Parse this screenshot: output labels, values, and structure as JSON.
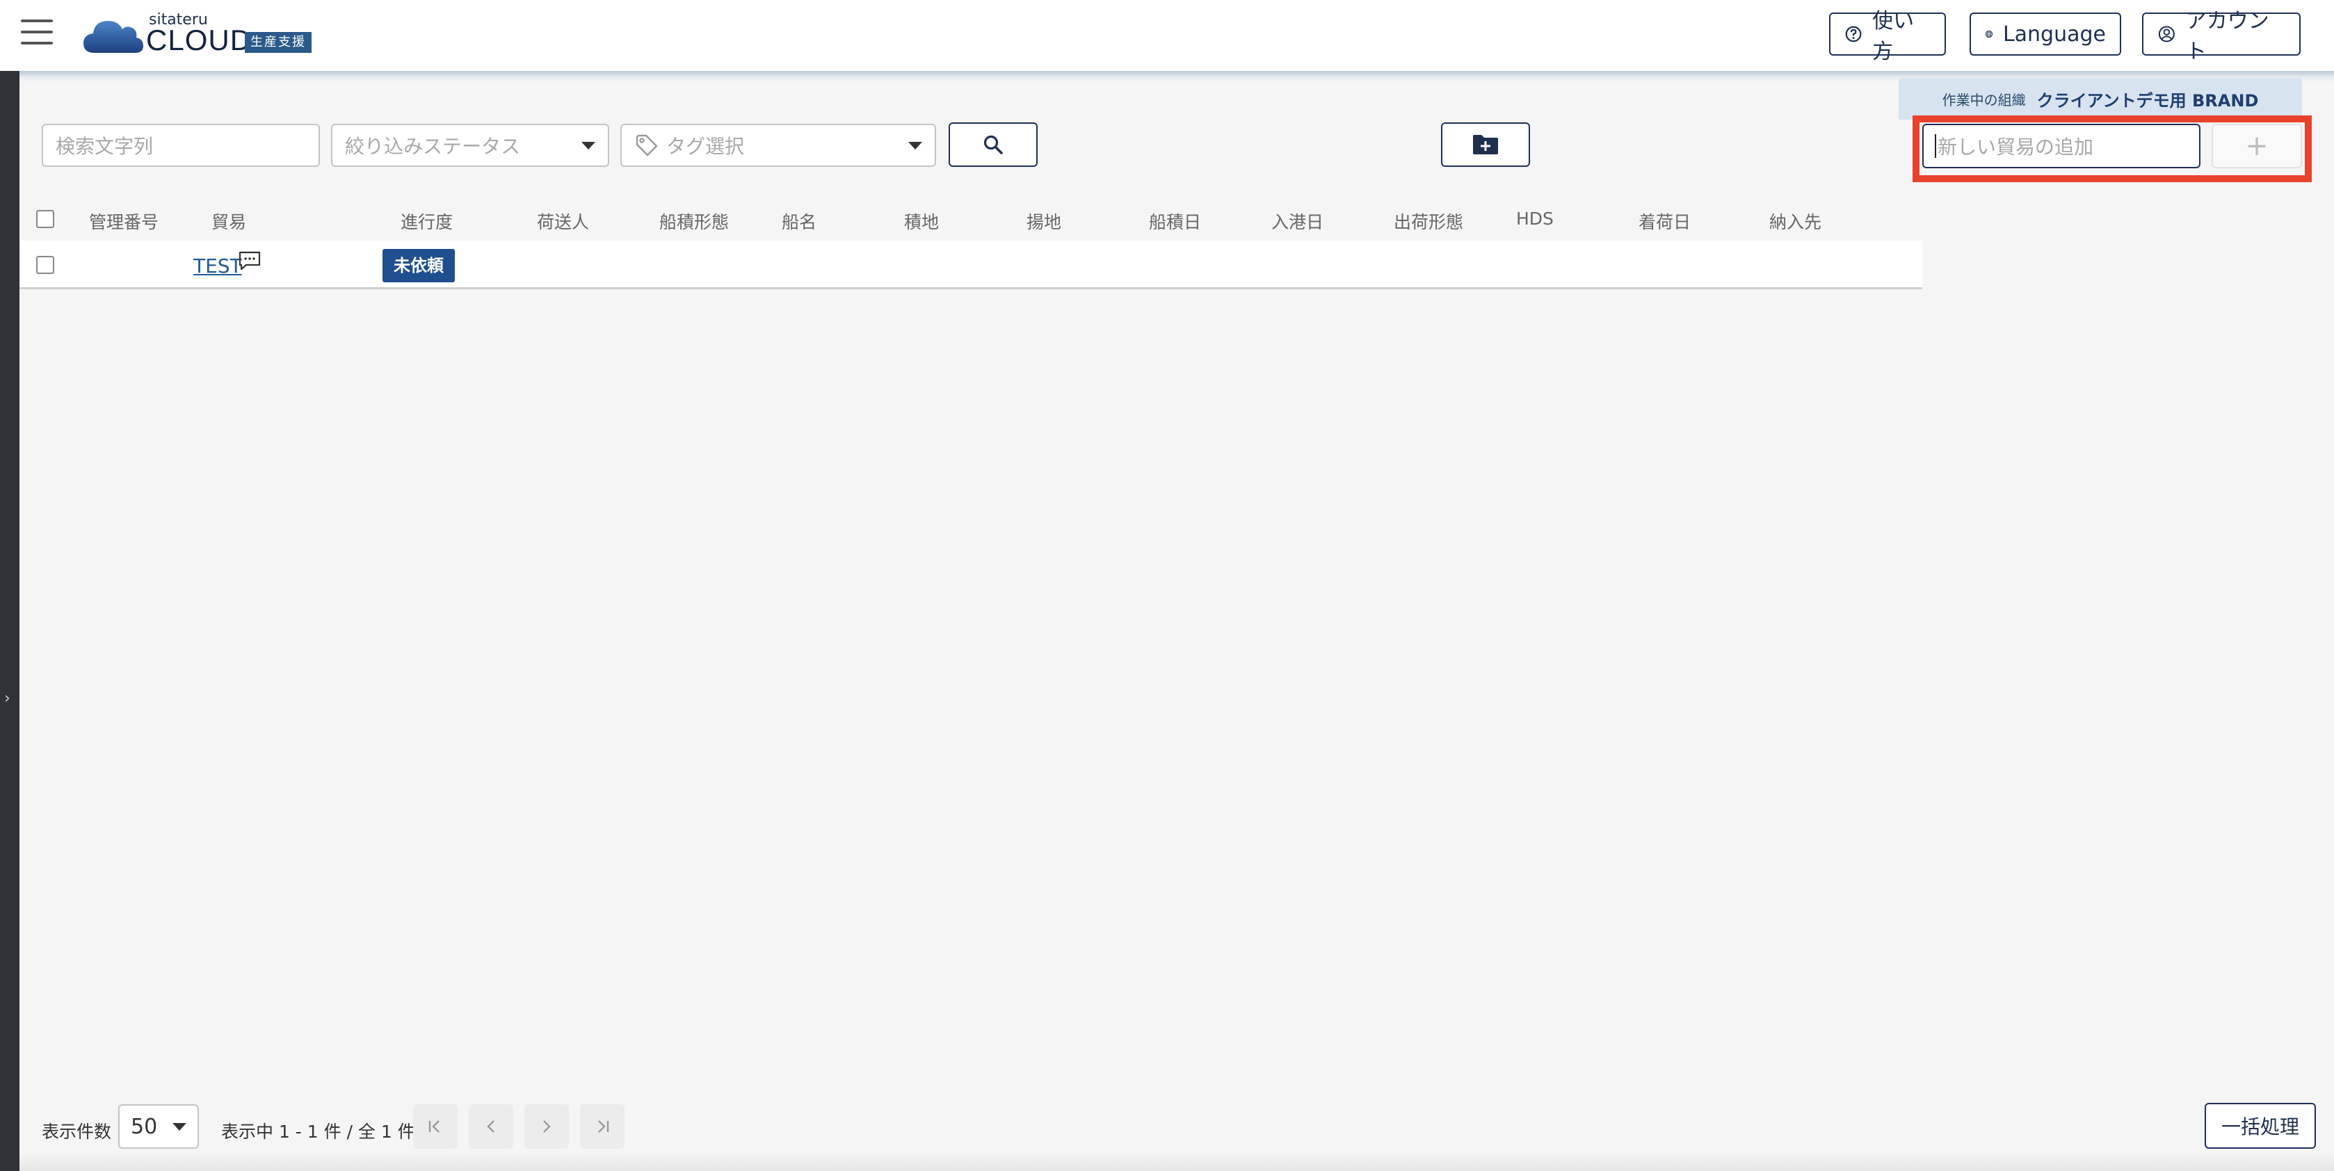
{
  "header": {
    "logo": {
      "small_text": "sitateru",
      "main_text": "CLOUD",
      "badge": "生産支援"
    },
    "help_label": "使い方",
    "language_label": "Language",
    "account_label": "アカウント"
  },
  "org": {
    "label": "作業中の組織",
    "name": "クライアントデモ用 BRAND"
  },
  "filters": {
    "search_placeholder": "検索文字列",
    "status_placeholder": "絞り込みステータス",
    "tag_placeholder": "タグ選択"
  },
  "add_trade": {
    "placeholder": "新しい貿易の追加",
    "button_label": "+"
  },
  "table": {
    "columns": [
      "管理番号",
      "貿易",
      "進行度",
      "荷送人",
      "船積形態",
      "船名",
      "積地",
      "揚地",
      "船積日",
      "入港日",
      "出荷形態",
      "HDS",
      "着荷日",
      "納入先"
    ],
    "rows": [
      {
        "trade": "TEST",
        "status": "未依頼"
      }
    ]
  },
  "footer": {
    "per_page_label": "表示件数",
    "per_page_value": "50",
    "range_text": "表示中 1 - 1 件 / 全 1 件",
    "bulk_label": "一括処理"
  },
  "colors": {
    "accent": "#1f2f5a",
    "status_badge": "#1f4f8f",
    "highlight": "#e8412c"
  }
}
